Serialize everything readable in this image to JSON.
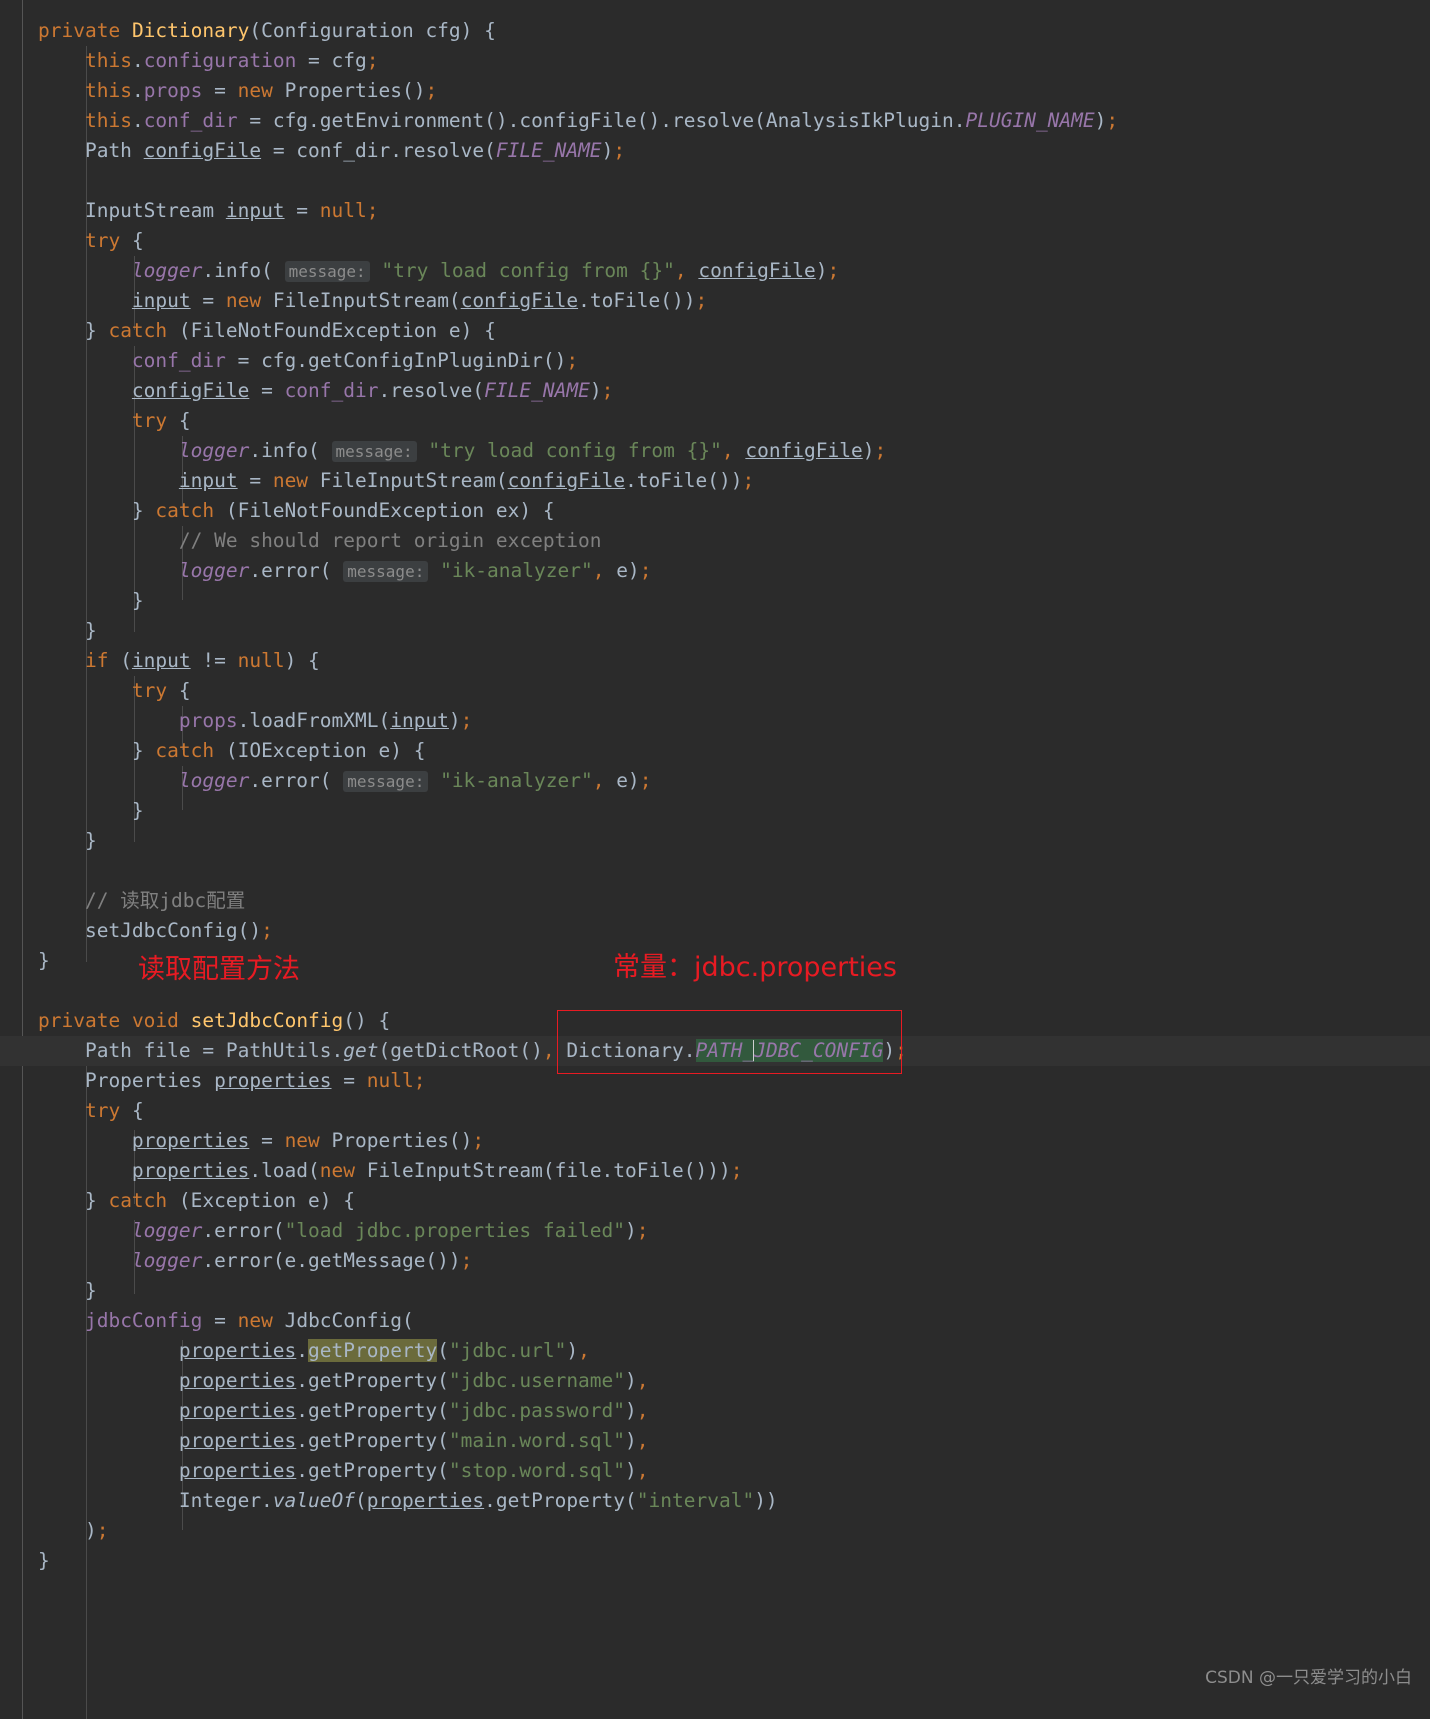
{
  "editor": {
    "language": "java",
    "theme": "darcula",
    "background": "#2b2b2b",
    "foreground": "#a9b7c6",
    "current_line_background": "#323232",
    "search_highlight_color": "#6b6b3c",
    "selection_highlight_color": "#32593d",
    "annotation_color": "#e81b23"
  },
  "lines": [
    {
      "id": 1,
      "indent": 0,
      "text": "private Dictionary(Configuration cfg) {"
    },
    {
      "id": 2,
      "indent": 1,
      "text": "this.configuration = cfg;"
    },
    {
      "id": 3,
      "indent": 1,
      "text": "this.props = new Properties();"
    },
    {
      "id": 4,
      "indent": 1,
      "text": "this.conf_dir = cfg.getEnvironment().configFile().resolve(AnalysisIkPlugin.PLUGIN_NAME);"
    },
    {
      "id": 5,
      "indent": 1,
      "text": "Path configFile = conf_dir.resolve(FILE_NAME);"
    },
    {
      "id": 6,
      "indent": 0,
      "text": ""
    },
    {
      "id": 7,
      "indent": 1,
      "text": "InputStream input = null;"
    },
    {
      "id": 8,
      "indent": 1,
      "text": "try {"
    },
    {
      "id": 9,
      "indent": 2,
      "text": "logger.info( message: \"try load config from {}\", configFile);"
    },
    {
      "id": 10,
      "indent": 2,
      "text": "input = new FileInputStream(configFile.toFile());"
    },
    {
      "id": 11,
      "indent": 1,
      "text": "} catch (FileNotFoundException e) {"
    },
    {
      "id": 12,
      "indent": 2,
      "text": "conf_dir = cfg.getConfigInPluginDir();"
    },
    {
      "id": 13,
      "indent": 2,
      "text": "configFile = conf_dir.resolve(FILE_NAME);"
    },
    {
      "id": 14,
      "indent": 2,
      "text": "try {"
    },
    {
      "id": 15,
      "indent": 3,
      "text": "logger.info( message: \"try load config from {}\", configFile);"
    },
    {
      "id": 16,
      "indent": 3,
      "text": "input = new FileInputStream(configFile.toFile());"
    },
    {
      "id": 17,
      "indent": 2,
      "text": "} catch (FileNotFoundException ex) {"
    },
    {
      "id": 18,
      "indent": 3,
      "text": "// We should report origin exception"
    },
    {
      "id": 19,
      "indent": 3,
      "text": "logger.error( message: \"ik-analyzer\", e);"
    },
    {
      "id": 20,
      "indent": 2,
      "text": "}"
    },
    {
      "id": 21,
      "indent": 1,
      "text": "}"
    },
    {
      "id": 22,
      "indent": 1,
      "text": "if (input != null) {"
    },
    {
      "id": 23,
      "indent": 2,
      "text": "try {"
    },
    {
      "id": 24,
      "indent": 3,
      "text": "props.loadFromXML(input);"
    },
    {
      "id": 25,
      "indent": 2,
      "text": "} catch (IOException e) {"
    },
    {
      "id": 26,
      "indent": 3,
      "text": "logger.error( message: \"ik-analyzer\", e);"
    },
    {
      "id": 27,
      "indent": 2,
      "text": "}"
    },
    {
      "id": 28,
      "indent": 1,
      "text": "}"
    },
    {
      "id": 29,
      "indent": 0,
      "text": ""
    },
    {
      "id": 30,
      "indent": 1,
      "text": "// 读取jdbc配置"
    },
    {
      "id": 31,
      "indent": 1,
      "text": "setJdbcConfig();"
    },
    {
      "id": 32,
      "indent": 0,
      "text": "}"
    },
    {
      "id": 33,
      "indent": 0,
      "text": ""
    },
    {
      "id": 34,
      "indent": 0,
      "text": "private void setJdbcConfig() {"
    },
    {
      "id": 35,
      "indent": 1,
      "text": "Path file = PathUtils.get(getDictRoot(), Dictionary.PATH_JDBC_CONFIG);"
    },
    {
      "id": 36,
      "indent": 1,
      "text": "Properties properties = null;"
    },
    {
      "id": 37,
      "indent": 1,
      "text": "try {"
    },
    {
      "id": 38,
      "indent": 2,
      "text": "properties = new Properties();"
    },
    {
      "id": 39,
      "indent": 2,
      "text": "properties.load(new FileInputStream(file.toFile()));"
    },
    {
      "id": 40,
      "indent": 1,
      "text": "} catch (Exception e) {"
    },
    {
      "id": 41,
      "indent": 2,
      "text": "logger.error(\"load jdbc.properties failed\");"
    },
    {
      "id": 42,
      "indent": 2,
      "text": "logger.error(e.getMessage());"
    },
    {
      "id": 43,
      "indent": 1,
      "text": "}"
    },
    {
      "id": 44,
      "indent": 1,
      "text": "jdbcConfig = new JdbcConfig("
    },
    {
      "id": 45,
      "indent": 3,
      "text": "properties.getProperty(\"jdbc.url\"),"
    },
    {
      "id": 46,
      "indent": 3,
      "text": "properties.getProperty(\"jdbc.username\"),"
    },
    {
      "id": 47,
      "indent": 3,
      "text": "properties.getProperty(\"jdbc.password\"),"
    },
    {
      "id": 48,
      "indent": 3,
      "text": "properties.getProperty(\"main.word.sql\"),"
    },
    {
      "id": 49,
      "indent": 3,
      "text": "properties.getProperty(\"stop.word.sql\"),"
    },
    {
      "id": 50,
      "indent": 3,
      "text": "Integer.valueOf(properties.getProperty(\"interval\"))"
    },
    {
      "id": 51,
      "indent": 1,
      "text": ");"
    },
    {
      "id": 52,
      "indent": 0,
      "text": "}"
    }
  ],
  "strings": {
    "try_load_config": "\"try load config from {}\"",
    "ik_analyzer": "\"ik-analyzer\"",
    "load_failed": "\"load jdbc.properties failed\"",
    "jdbc_url": "\"jdbc.url\"",
    "jdbc_username": "\"jdbc.username\"",
    "jdbc_password": "\"jdbc.password\"",
    "main_word_sql": "\"main.word.sql\"",
    "stop_word_sql": "\"stop.word.sql\"",
    "interval": "\"interval\""
  },
  "param_hints": {
    "message": "message:"
  },
  "comments": {
    "origin_exception": "// We should report origin exception",
    "read_jdbc_config": "// 读取jdbc配置"
  },
  "annotations": [
    {
      "id": "method-annotation",
      "text": "读取配置方法"
    },
    {
      "id": "constant-annotation",
      "text": "常量：jdbc.properties"
    }
  ],
  "highlights": {
    "boxed_expression": "Dictionary.PATH_JDBC_CONFIG",
    "search_term": "getProperty"
  },
  "watermark": {
    "text": "CSDN @一只爱学习的小白"
  }
}
